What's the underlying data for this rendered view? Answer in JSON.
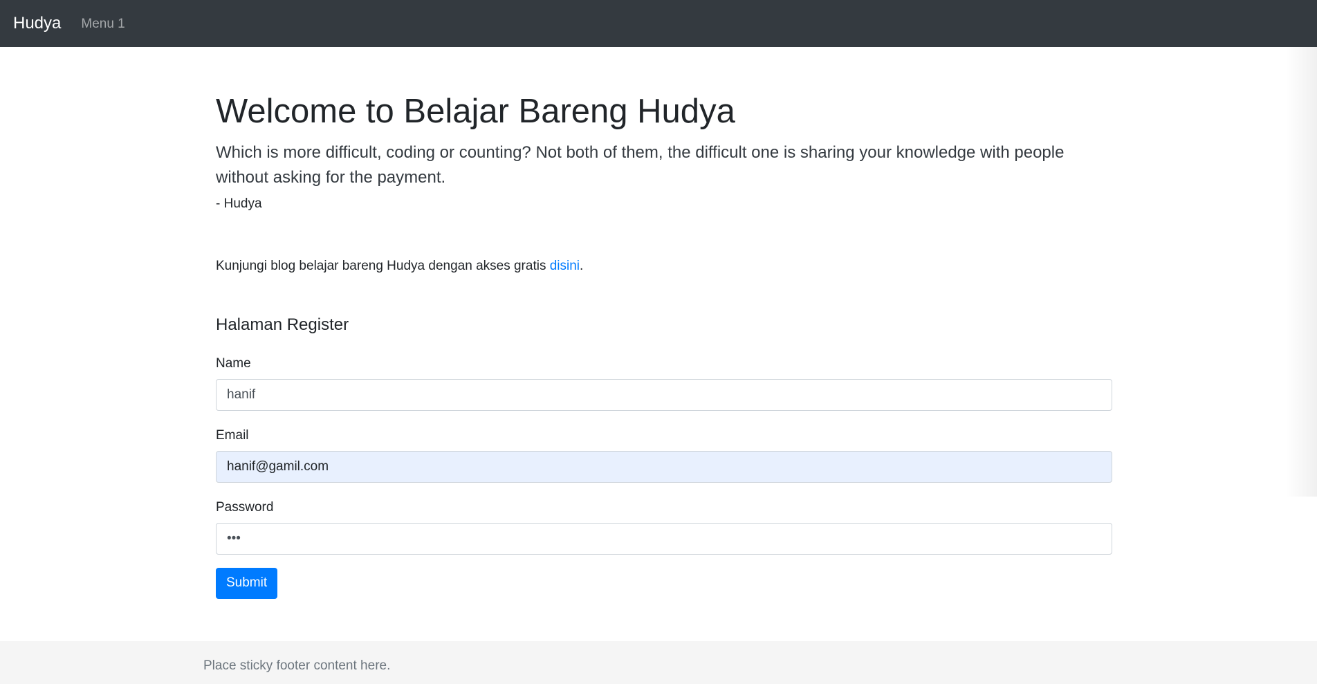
{
  "navbar": {
    "brand": "Hudya",
    "menu_item": "Menu 1"
  },
  "hero": {
    "title": "Welcome to Belajar Bareng Hudya",
    "lead": "Which is more difficult, coding or counting? Not both of them, the difficult one is sharing your knowledge with people without asking for the payment.",
    "author": "- Hudya"
  },
  "blog": {
    "text": "Kunjungi blog belajar bareng Hudya dengan akses gratis ",
    "link": "disini",
    "suffix": "."
  },
  "register": {
    "heading": "Halaman Register",
    "name_label": "Name",
    "name_value": "hanif",
    "email_label": "Email",
    "email_value": "hanif@gamil.com",
    "password_label": "Password",
    "password_value": "abc",
    "submit_label": "Submit"
  },
  "footer": {
    "text": "Place sticky footer content here."
  },
  "colors": {
    "navbar_bg": "#343a40",
    "primary": "#007bff",
    "footer_bg": "#f5f5f5",
    "autofill_bg": "#e8f0fe"
  }
}
